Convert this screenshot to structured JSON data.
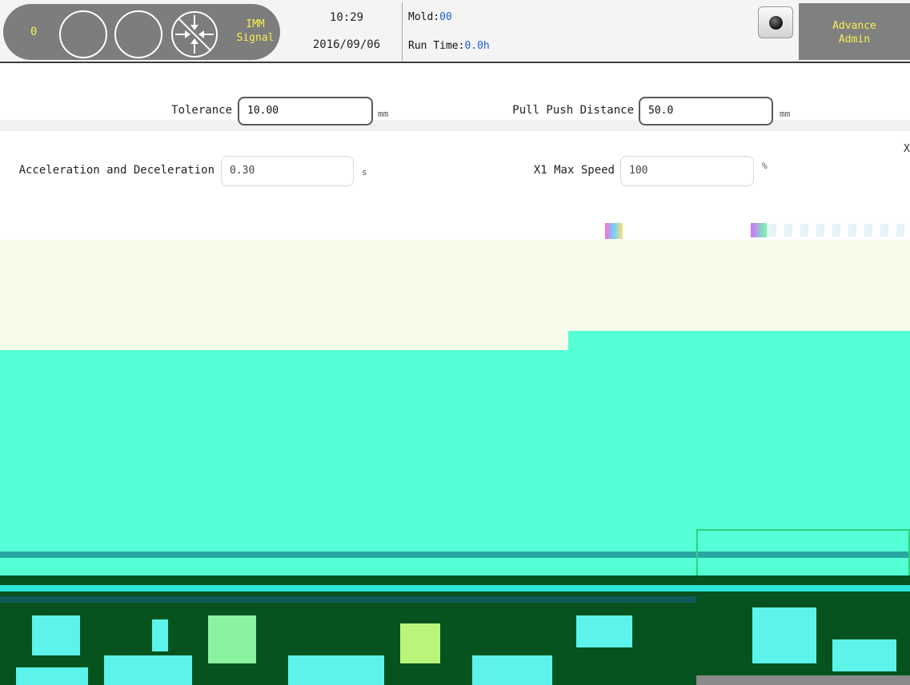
{
  "header": {
    "signal_count": "0",
    "signal_label_line1": "IMM",
    "signal_label_line2": "Signal",
    "time": "10:29",
    "date": "2016/09/06",
    "mold_label": "Mold:",
    "mold_value": "00",
    "runtime_label": "Run Time:",
    "runtime_value": "0.0h",
    "user_line1": "Advance",
    "user_line2": "Admin",
    "icons": [
      "circle-icon",
      "circle-icon",
      "circle-icon",
      "signal-blocked-icon",
      "camera-icon"
    ]
  },
  "params": {
    "tolerance_label": "Tolerance",
    "tolerance_value": "10.00",
    "tolerance_unit": "mm",
    "pullpush_label": "Pull Push Distance",
    "pullpush_value": "50.0",
    "pullpush_unit": "mm",
    "accel_label": "Acceleration and Deceleration",
    "accel_value": "0.30",
    "accel_unit": "s",
    "maxspeed_label": "X1 Max Speed",
    "maxspeed_value": "100",
    "maxspeed_unit": "%",
    "edge_label": "X"
  },
  "colors": {
    "header_bg": "#f4f4f4",
    "pill": "#7d7d7d",
    "accent_yellow": "#f5f050",
    "value_blue": "#1f5fd0",
    "panel_cyan": "#55ffd6",
    "panel_dark": "#07531f",
    "panel_cream": "#f7fbe9"
  }
}
